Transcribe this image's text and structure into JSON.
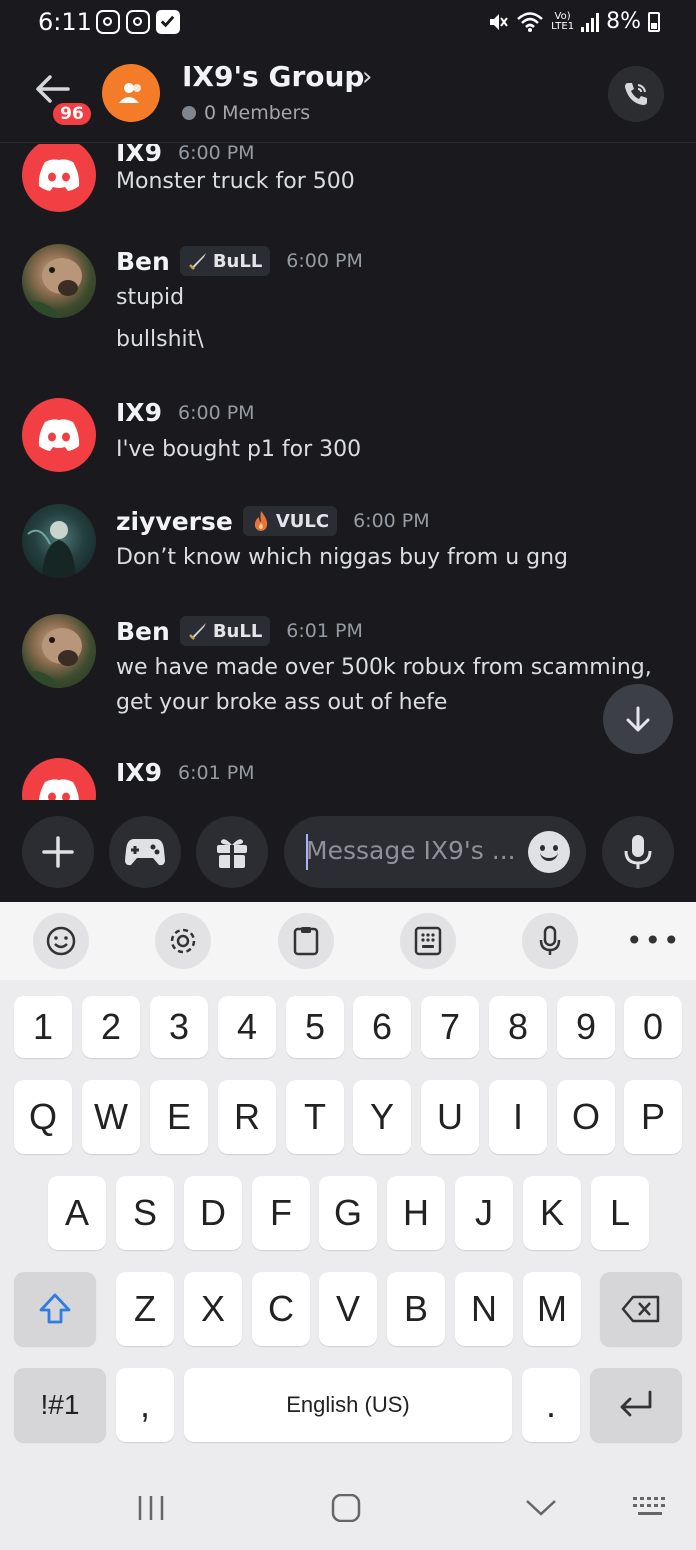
{
  "status_bar": {
    "time": "6:11",
    "network_top": "Vo)",
    "network_bottom": "LTE1",
    "battery": "8%"
  },
  "header": {
    "unread_count": "96",
    "group_name": "IX9's Group",
    "members": "0 Members"
  },
  "messages": [
    {
      "author": "IX9",
      "tag": "",
      "tag_icon": "",
      "time": "6:00 PM",
      "lines": [
        "Monster truck for 500"
      ],
      "avatar": "discord-icon"
    },
    {
      "author": "Ben",
      "tag": "BuLL",
      "tag_icon": "sword-icon",
      "time": "6:00 PM",
      "lines": [
        "stupid",
        "bullshit\\"
      ],
      "avatar": "dog-photo"
    },
    {
      "author": "IX9",
      "tag": "",
      "tag_icon": "",
      "time": "6:00 PM",
      "lines": [
        "I've bought p1 for 300"
      ],
      "avatar": "discord-icon"
    },
    {
      "author": "ziyverse",
      "tag": "VULC",
      "tag_icon": "flame-icon",
      "time": "6:00 PM",
      "lines": [
        "Don’t know which niggas buy from u gng"
      ],
      "avatar": "figure-photo"
    },
    {
      "author": "Ben",
      "tag": "BuLL",
      "tag_icon": "sword-icon",
      "time": "6:01 PM",
      "lines": [
        "we have made over 500k robux from scamming, get your broke ass out of hefe"
      ],
      "avatar": "dog-photo"
    },
    {
      "author": "IX9",
      "tag": "",
      "tag_icon": "",
      "time": "6:01 PM",
      "lines": [],
      "avatar": "discord-icon"
    }
  ],
  "composer": {
    "placeholder": "Message IX9's ..."
  },
  "keyboard": {
    "row_numbers": [
      "1",
      "2",
      "3",
      "4",
      "5",
      "6",
      "7",
      "8",
      "9",
      "0"
    ],
    "row_top": [
      "Q",
      "W",
      "E",
      "R",
      "T",
      "Y",
      "U",
      "I",
      "O",
      "P"
    ],
    "row_middle": [
      "A",
      "S",
      "D",
      "F",
      "G",
      "H",
      "J",
      "K",
      "L"
    ],
    "row_bottom": [
      "Z",
      "X",
      "C",
      "V",
      "B",
      "N",
      "M"
    ],
    "symbols_key": "!#1",
    "comma_key": ",",
    "space_label": "English (US)",
    "period_key": ".",
    "toolbar_more": "•••"
  },
  "colors": {
    "discord_red": "#f23f43",
    "group_orange": "#f47b28",
    "background": "#1a1a1e",
    "accent_blue": "#2f7de1"
  }
}
